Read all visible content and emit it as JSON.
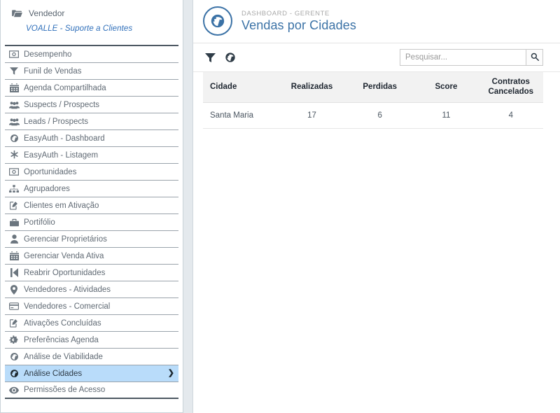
{
  "sidebar": {
    "user_role": "Vendedor",
    "user_icon": "folder-open-icon",
    "company": "VOALLE - Suporte a Clientes",
    "items": [
      {
        "label": "Desempenho",
        "icon": "money-bill-icon",
        "active": false
      },
      {
        "label": "Funil de Vendas",
        "icon": "filter-icon",
        "active": false
      },
      {
        "label": "Agenda Compartilhada",
        "icon": "calendar-icon",
        "active": false
      },
      {
        "label": "Suspects / Prospects",
        "icon": "users-icon",
        "active": false
      },
      {
        "label": "Leads / Prospects",
        "icon": "users-icon",
        "active": false
      },
      {
        "label": "EasyAuth - Dashboard",
        "icon": "globe-icon",
        "active": false
      },
      {
        "label": "EasyAuth - Listagem",
        "icon": "asterisk-icon",
        "active": false
      },
      {
        "label": "Oportunidades",
        "icon": "money-bill-icon",
        "active": false
      },
      {
        "label": "Agrupadores",
        "icon": "sitemap-icon",
        "active": false
      },
      {
        "label": "Clientes em Ativação",
        "icon": "pencil-square-icon",
        "active": false
      },
      {
        "label": "Portifólio",
        "icon": "briefcase-icon",
        "active": false
      },
      {
        "label": "Gerenciar Proprietários",
        "icon": "user-icon",
        "active": false
      },
      {
        "label": "Gerenciar Venda Ativa",
        "icon": "calendar-icon",
        "active": false
      },
      {
        "label": "Reabrir Oportunidades",
        "icon": "step-backward-icon",
        "active": false
      },
      {
        "label": "Vendedores - Atividades",
        "icon": "map-marker-icon",
        "active": false
      },
      {
        "label": "Vendedores - Comercial",
        "icon": "credit-card-icon",
        "active": false
      },
      {
        "label": "Ativações Concluídas",
        "icon": "pencil-square-icon",
        "active": false
      },
      {
        "label": "Preferências Agenda",
        "icon": "cogs-icon",
        "active": false
      },
      {
        "label": "Análise de Viabilidade",
        "icon": "globe-icon",
        "active": false
      },
      {
        "label": "Análise Cidades",
        "icon": "globe-icon",
        "active": true,
        "chevron": "❯"
      },
      {
        "label": "Permissões de Acesso",
        "icon": "eye-icon",
        "active": false
      }
    ]
  },
  "page": {
    "avatar_icon": "globe-circle-icon",
    "subtitle": "DASHBOARD - GERENTE",
    "title": "Vendas por Cidades",
    "accent_color": "#3b72a6",
    "highlight_color": "#b9dcfa"
  },
  "toolbar": {
    "filter_icon": "filter-icon",
    "globe_icon": "globe-icon",
    "search_placeholder": "Pesquisar...",
    "search_value": "",
    "search_button_icon": "search-icon"
  },
  "table": {
    "columns": [
      {
        "label": "Cidade",
        "align": "left"
      },
      {
        "label": "Realizadas",
        "align": "center"
      },
      {
        "label": "Perdidas",
        "align": "center"
      },
      {
        "label": "Score",
        "align": "center"
      },
      {
        "label": "Contratos Cancelados",
        "align": "center"
      }
    ],
    "rows": [
      {
        "cidade": "Santa Maria",
        "realizadas": "17",
        "perdidas": "6",
        "score": "11",
        "contratos_cancelados": "4"
      }
    ]
  }
}
